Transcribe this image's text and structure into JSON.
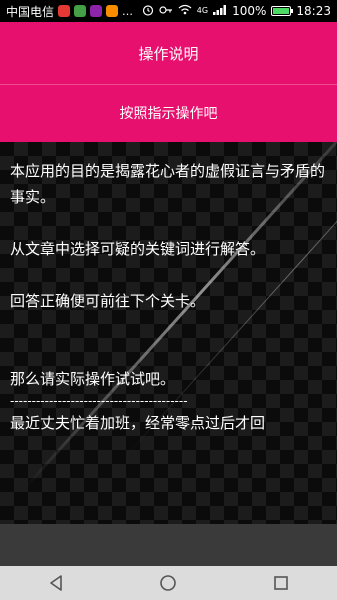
{
  "status_bar": {
    "carrier": "中国电信",
    "battery_percent": "100%",
    "time": "18:23",
    "network": "4G"
  },
  "header": {
    "title": "操作说明",
    "subtitle": "按照指示操作吧"
  },
  "content": {
    "paragraphs": [
      "本应用的目的是揭露花心者的虚假证言与矛盾的事实。",
      "从文章中选择可疑的关键词进行解答。",
      "回答正确便可前往下个关卡。",
      "那么请实际操作试试吧。",
      "-----------------------------------------",
      "最近丈夫忙着加班，经常零点过后才回"
    ]
  },
  "colors": {
    "accent": "#e8106e",
    "background": "#000000",
    "nav_bar": "#dcdcdc",
    "bottom_panel": "#3a3a3a"
  },
  "nav": {
    "icons": [
      "back-icon",
      "home-icon",
      "recent-apps-icon"
    ]
  }
}
